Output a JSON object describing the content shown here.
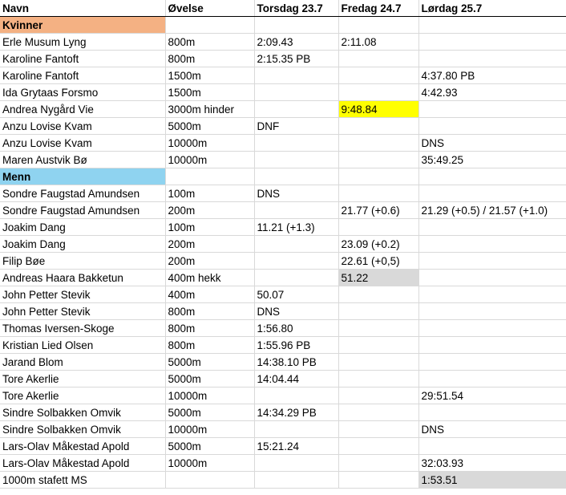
{
  "headers": [
    "Navn",
    "Øvelse",
    "Torsdag 23.7",
    "Fredag 24.7",
    "Lørdag 25.7"
  ],
  "colors": {
    "women_section": "#f4b183",
    "men_section": "#8fd3f0",
    "highlight_yellow": "#ffff00",
    "highlight_gray": "#d9d9d9"
  },
  "sections": {
    "women": "Kvinner",
    "men": "Menn"
  },
  "women": [
    [
      "Erle Musum Lyng",
      "800m",
      "2:09.43",
      "2:11.08",
      ""
    ],
    [
      "Karoline Fantoft",
      "800m",
      "2:15.35 PB",
      "",
      ""
    ],
    [
      "Karoline Fantoft",
      "1500m",
      "",
      "",
      "4:37.80 PB"
    ],
    [
      "Ida Grytaas Forsmo",
      "1500m",
      "",
      "",
      "4:42.93"
    ],
    [
      "Andrea Nygård Vie",
      "3000m hinder",
      "",
      "9:48.84",
      ""
    ],
    [
      "Anzu Lovise Kvam",
      "5000m",
      "DNF",
      "",
      ""
    ],
    [
      "Anzu Lovise Kvam",
      "10000m",
      "",
      "",
      "DNS"
    ],
    [
      "Maren Austvik Bø",
      "10000m",
      "",
      "",
      "35:49.25"
    ]
  ],
  "men": [
    [
      "Sondre Faugstad Amundsen",
      "100m",
      "DNS",
      "",
      ""
    ],
    [
      "Sondre Faugstad Amundsen",
      "200m",
      "",
      "21.77 (+0.6)",
      "21.29 (+0.5) /  21.57 (+1.0)"
    ],
    [
      "Joakim Dang",
      "100m",
      "11.21 (+1.3)",
      "",
      ""
    ],
    [
      "Joakim Dang",
      "200m",
      "",
      "23.09 (+0.2)",
      ""
    ],
    [
      "Filip Bøe",
      "200m",
      "",
      "22.61 (+0,5)",
      ""
    ],
    [
      "Andreas Haara Bakketun",
      "400m hekk",
      "",
      "51.22",
      ""
    ],
    [
      "John Petter Stevik",
      "400m",
      "50.07",
      "",
      ""
    ],
    [
      "John Petter Stevik",
      "800m",
      "DNS",
      "",
      ""
    ],
    [
      "Thomas Iversen-Skoge",
      "800m",
      "1:56.80",
      "",
      ""
    ],
    [
      "Kristian Lied Olsen",
      "800m",
      "1:55.96 PB",
      "",
      ""
    ],
    [
      "Jarand Blom",
      "5000m",
      "14:38.10 PB",
      "",
      ""
    ],
    [
      "Tore Akerlie",
      "5000m",
      "14:04.44",
      "",
      ""
    ],
    [
      "Tore Akerlie",
      "10000m",
      "",
      "",
      "29:51.54"
    ],
    [
      "Sindre Solbakken Omvik",
      "5000m",
      "14:34.29 PB",
      "",
      ""
    ],
    [
      "Sindre Solbakken Omvik",
      "10000m",
      "",
      "",
      "DNS"
    ],
    [
      "Lars-Olav Måkestad Apold",
      "5000m",
      "15:21.24",
      "",
      ""
    ],
    [
      "Lars-Olav Måkestad Apold",
      "10000m",
      "",
      "",
      "32:03.93"
    ],
    [
      "1000m stafett MS",
      "",
      "",
      "",
      "1:53.51"
    ]
  ]
}
